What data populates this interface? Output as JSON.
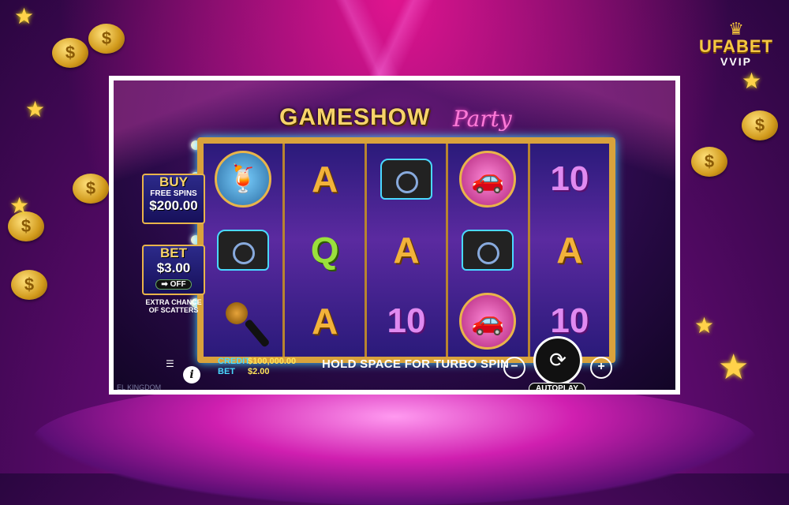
{
  "branding": {
    "logo_text": "UFABET",
    "logo_sub": "VVIP"
  },
  "game": {
    "title_main": "GAMESHOW",
    "title_script": "Party",
    "reels": [
      [
        "cocktail",
        "phone",
        "microphone"
      ],
      [
        "A",
        "Q",
        "A"
      ],
      [
        "phone",
        "A",
        "10"
      ],
      [
        "car",
        "phone",
        "car"
      ],
      [
        "10",
        "A",
        "10"
      ]
    ],
    "buy_panel": {
      "heading": "BUY",
      "sub": "FREE SPINS",
      "price": "$200.00"
    },
    "bet_panel": {
      "heading": "BET",
      "value": "$3.00",
      "toggle": "OFF",
      "note": "EXTRA CHANCE OF SCATTERS"
    },
    "footer": {
      "credit_label": "CREDIT",
      "credit_value": "$100,000.00",
      "bet_label": "BET",
      "bet_value": "$2.00",
      "hint": "HOLD SPACE FOR TURBO SPIN",
      "autoplay_label": "AUTOPLAY",
      "provider_fragment": "EL KINGDOM"
    }
  },
  "icons": [
    "coin-icon",
    "star-icon",
    "menu-icon",
    "info-icon",
    "minus-icon",
    "plus-icon",
    "spin-icon",
    "crown-icon"
  ],
  "colors": {
    "gold": "#f2b23a",
    "pink": "#ff4fd8",
    "cyan": "#4ad9ff"
  }
}
